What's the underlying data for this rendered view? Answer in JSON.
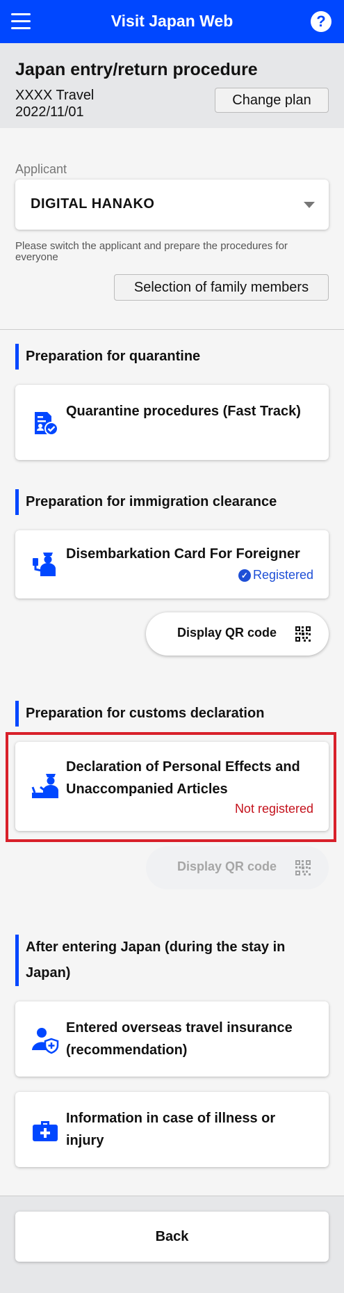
{
  "app": {
    "title": "Visit Japan Web"
  },
  "plan": {
    "heading": "Japan entry/return procedure",
    "name": "XXXX Travel",
    "date": "2022/11/01",
    "change_label": "Change plan"
  },
  "applicant": {
    "label": "Applicant",
    "selected": "DIGITAL HANAKO",
    "note": "Please switch the applicant and prepare the procedures for everyone",
    "family_button": "Selection of family members"
  },
  "sections": {
    "quarantine": {
      "heading": "Preparation for quarantine",
      "card_title": "Quarantine procedures (Fast Track)",
      "icon": "quarantine-document-icon"
    },
    "immigration": {
      "heading": "Preparation for immigration clearance",
      "card_title": "Disembarkation Card For Foreigner",
      "status": "Registered",
      "qr_label": "Display QR code",
      "icon": "immigration-officer-icon"
    },
    "customs": {
      "heading": "Preparation for customs declaration",
      "card_title": "Declaration of Personal Effects and Unaccompanied Articles",
      "status": "Not registered",
      "qr_label": "Display QR code",
      "icon": "customs-officer-icon"
    },
    "after_entry": {
      "heading": "After entering Japan (during the stay in Japan)",
      "insurance_title": "Entered overseas travel insurance (recommendation)",
      "illness_title": "Information in case of illness or injury",
      "insurance_icon": "insurance-user-icon",
      "illness_icon": "medical-kit-icon"
    }
  },
  "footer": {
    "back_label": "Back"
  },
  "colors": {
    "brand": "#0047ff",
    "registered": "#1e4fd6",
    "not_registered": "#c4121c",
    "highlight": "#d8202a"
  }
}
